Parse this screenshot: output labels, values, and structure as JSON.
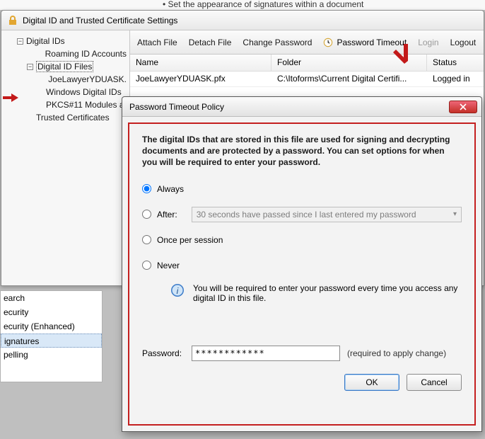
{
  "truncated_line": "• Set the appearance of signatures within a document",
  "window": {
    "title": "Digital ID and Trusted Certificate Settings"
  },
  "tree": {
    "root": "Digital IDs",
    "items": [
      "Roaming ID Accounts",
      "Digital ID Files",
      "JoeLawyerYDUASK.",
      "Windows Digital IDs",
      "PKCS#11 Modules a"
    ],
    "trusted": "Trusted Certificates"
  },
  "toolbar": {
    "attach": "Attach File",
    "detach": "Detach File",
    "change_pw": "Change Password",
    "timeout": "Password Timeout",
    "login": "Login",
    "logout": "Logout"
  },
  "table": {
    "headers": {
      "name": "Name",
      "folder": "Folder",
      "status": "Status"
    },
    "row": {
      "name": "JoeLawyerYDUASK.pfx",
      "folder": "C:\\Itoforms\\Current Digital Certifi...",
      "status": "Logged in"
    }
  },
  "left_panel": {
    "items": [
      "earch",
      "ecurity",
      "ecurity (Enhanced)",
      "ignatures",
      "pelling"
    ]
  },
  "dialog": {
    "title": "Password Timeout Policy",
    "explain": "The digital IDs that are stored in this file are used for signing and decrypting documents and are protected by a password. You can set options for when you will be required to enter your password.",
    "radios": {
      "always": "Always",
      "after": "After:",
      "after_value": "30 seconds have passed since I last entered my password",
      "once": "Once per session",
      "never": "Never"
    },
    "info_text": "You will be required to enter your password every time you access any digital ID in this file.",
    "password_label": "Password:",
    "password_value": "************",
    "required_text": "(required to apply change)",
    "ok": "OK",
    "cancel": "Cancel"
  }
}
